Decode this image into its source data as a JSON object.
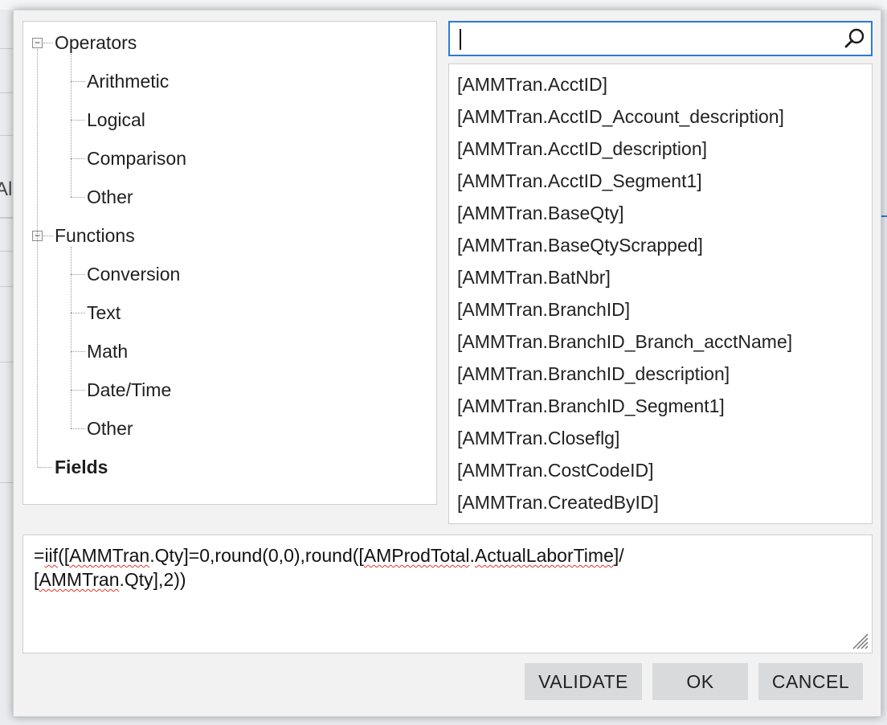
{
  "background": {
    "fragment_text": "Al"
  },
  "tree": {
    "groups": [
      {
        "label": "Operators",
        "children": [
          "Arithmetic",
          "Logical",
          "Comparison",
          "Other"
        ]
      },
      {
        "label": "Functions",
        "children": [
          "Conversion",
          "Text",
          "Math",
          "Date/Time",
          "Other"
        ]
      }
    ],
    "fields_label": "Fields",
    "collapse_symbol": "−"
  },
  "search": {
    "value": "",
    "icon": "search-icon"
  },
  "fields": [
    "[AMMTran.AcctID]",
    "[AMMTran.AcctID_Account_description]",
    "[AMMTran.AcctID_description]",
    "[AMMTran.AcctID_Segment1]",
    "[AMMTran.BaseQty]",
    "[AMMTran.BaseQtyScrapped]",
    "[AMMTran.BatNbr]",
    "[AMMTran.BranchID]",
    "[AMMTran.BranchID_Branch_acctName]",
    "[AMMTran.BranchID_description]",
    "[AMMTran.BranchID_Segment1]",
    "[AMMTran.Closeflg]",
    "[AMMTran.CostCodeID]",
    "[AMMTran.CreatedByID]"
  ],
  "expression": {
    "line1": {
      "p1": "=",
      "p2": "iif",
      "p3": "([",
      "p4": "AMMTran",
      "p5": ".Qty]=0,round(0,0),round([",
      "p6": "AMProdTotal",
      "p7": ".",
      "p8": "ActualLaborTime",
      "p9": "]/"
    },
    "line2": {
      "p1": "[",
      "p2": "AMMTran",
      "p3": ".Qty],2))"
    }
  },
  "buttons": {
    "validate": "VALIDATE",
    "ok": "OK",
    "cancel": "CANCEL"
  },
  "colors": {
    "accent": "#2b7bd6",
    "button_bg": "#d9dadb",
    "dialog_bg": "#f2f2f2",
    "spellcheck": "#e0352b"
  }
}
